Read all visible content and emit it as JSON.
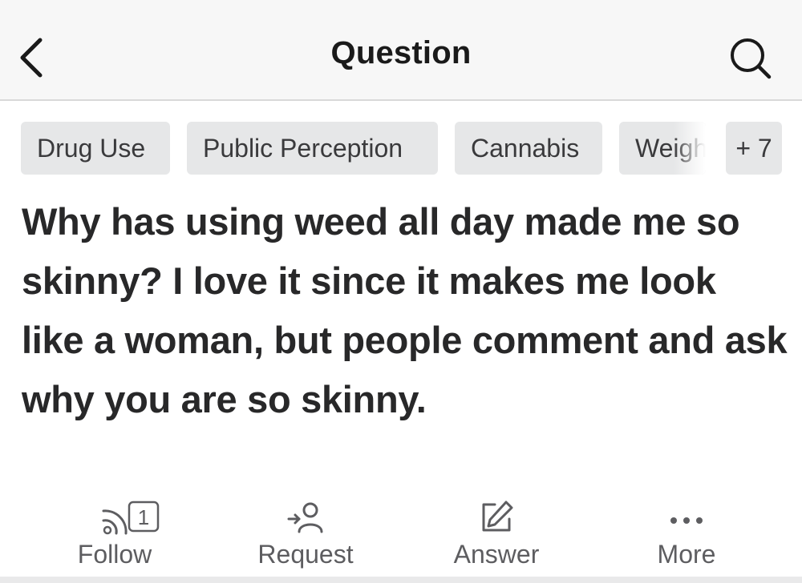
{
  "header": {
    "title": "Question",
    "back_icon": "chevron-left-icon",
    "search_icon": "search-icon"
  },
  "topics": [
    {
      "label": "Drug Use"
    },
    {
      "label": "Public Perception"
    },
    {
      "label": "Cannabis"
    },
    {
      "label": "Weigh"
    },
    {
      "label": "+ 7"
    }
  ],
  "question": {
    "text": "Why has using weed all day made me so skinny? I love it since it makes me look like a woman, but people comment and ask why you are so skinny."
  },
  "actions": {
    "follow": {
      "label": "Follow",
      "count": "1",
      "icon": "follow-feed-icon"
    },
    "request": {
      "label": "Request",
      "icon": "request-user-icon"
    },
    "answer": {
      "label": "Answer",
      "icon": "pencil-icon"
    },
    "more": {
      "label": "More",
      "icon": "more-dots-icon"
    }
  }
}
